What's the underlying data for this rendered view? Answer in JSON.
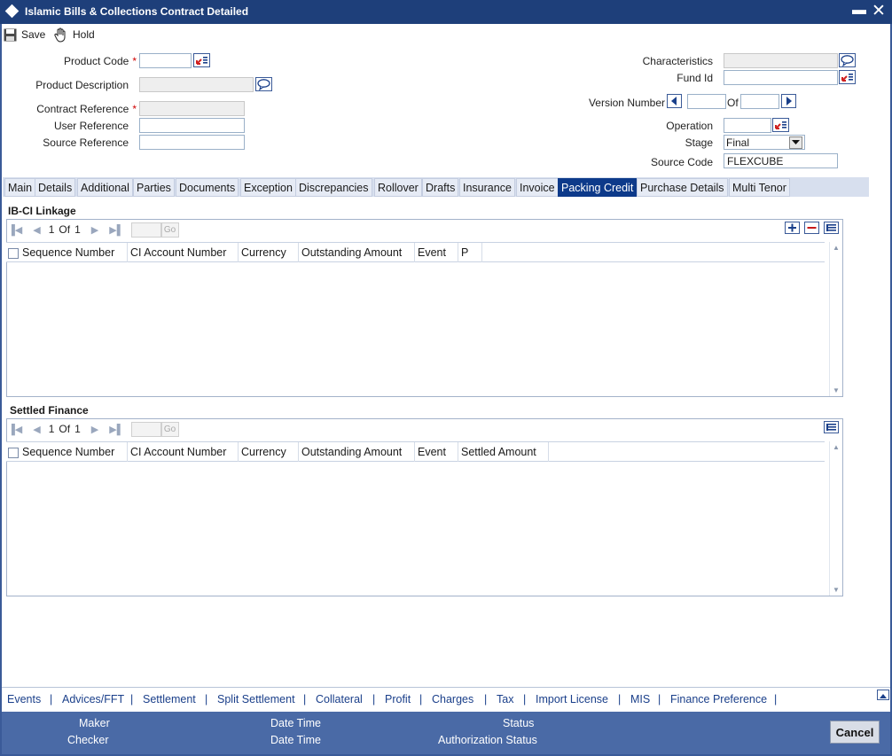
{
  "window": {
    "title": "Islamic Bills & Collections Contract Detailed"
  },
  "toolbar": {
    "save": "Save",
    "hold": "Hold"
  },
  "form": {
    "product_code_label": "Product Code",
    "product_code_value": "",
    "product_description_label": "Product Description",
    "contract_reference_label": "Contract Reference",
    "user_reference_label": "User Reference",
    "source_reference_label": "Source Reference",
    "characteristics_label": "Characteristics",
    "fund_id_label": "Fund Id",
    "version_number_label": "Version Number",
    "of_label": "Of",
    "operation_label": "Operation",
    "stage_label": "Stage",
    "stage_value": "Final",
    "source_code_label": "Source Code",
    "source_code_value": "FLEXCUBE",
    "required_mark": "*"
  },
  "tabs": [
    "Main",
    "Details",
    "Additional",
    "Parties",
    "Documents",
    "Exception",
    "Discrepancies",
    "Rollover",
    "Drafts",
    "Insurance",
    "Invoice",
    "Packing Credit",
    "Purchase Details",
    "Multi Tenor"
  ],
  "active_tab": "Packing Credit",
  "linkage": {
    "title": "IB-CI Linkage",
    "pager": {
      "current": "1",
      "of": "Of",
      "total": "1",
      "go": "Go"
    },
    "columns": [
      "Sequence Number",
      "CI Account Number",
      "Currency",
      "Outstanding Amount",
      "Event",
      "P"
    ]
  },
  "settled": {
    "title": "Settled Finance",
    "pager": {
      "current": "1",
      "of": "Of",
      "total": "1",
      "go": "Go"
    },
    "columns": [
      "Sequence Number",
      "CI Account Number",
      "Currency",
      "Outstanding Amount",
      "Event",
      "Settled Amount"
    ]
  },
  "bottom_links": [
    "Events",
    "Advices/FFT",
    "Settlement",
    "Split Settlement",
    "Collateral",
    "Profit",
    "Charges",
    "Tax",
    "Import License",
    "MIS",
    "Finance Preference"
  ],
  "footer": {
    "maker": "Maker",
    "checker": "Checker",
    "date_time_1": "Date Time",
    "date_time_2": "Date Time",
    "status": "Status",
    "authorization_status": "Authorization Status",
    "cancel": "Cancel"
  },
  "colors": {
    "titlebar": "#1e3f7a",
    "active_tab": "#0d3a8a",
    "footer": "#4a6aa6",
    "link": "#1a3f8a"
  }
}
